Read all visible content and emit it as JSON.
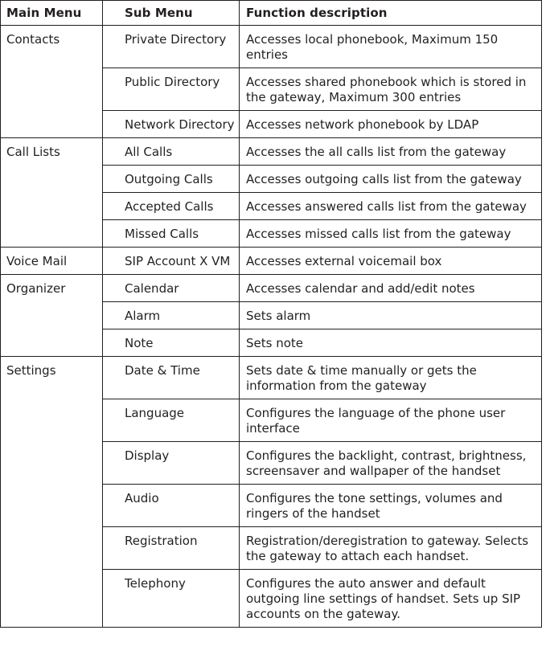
{
  "table": {
    "headers": {
      "main_menu": "Main Menu",
      "sub_menu": "Sub Menu",
      "function_description": "Function description"
    },
    "groups": [
      {
        "main": "Contacts",
        "rows": [
          {
            "sub": "Private Directory",
            "desc": "Accesses local phonebook, Maximum 150 entries"
          },
          {
            "sub": "Public Directory",
            "desc": "Accesses shared phonebook which is stored in the gateway, Maximum 300 entries"
          },
          {
            "sub": "Network Directory",
            "desc": "Accesses network phonebook by LDAP"
          }
        ]
      },
      {
        "main": "Call Lists",
        "rows": [
          {
            "sub": "All Calls",
            "desc": "Accesses the all calls list from the gateway"
          },
          {
            "sub": "Outgoing Calls",
            "desc": "Accesses outgoing calls list from the gateway"
          },
          {
            "sub": "Accepted Calls",
            "desc": "Accesses answered calls list from the gateway"
          },
          {
            "sub": "Missed Calls",
            "desc": "Accesses missed calls list from the gateway"
          }
        ]
      },
      {
        "main": "Voice Mail",
        "rows": [
          {
            "sub": "SIP Account X VM",
            "desc": "Accesses external voicemail box"
          }
        ]
      },
      {
        "main": "Organizer",
        "rows": [
          {
            "sub": "Calendar",
            "desc": "Accesses calendar and add/edit notes"
          },
          {
            "sub": "Alarm",
            "desc": "Sets alarm"
          },
          {
            "sub": "Note",
            "desc": "Sets note"
          }
        ]
      },
      {
        "main": "Settings",
        "rows": [
          {
            "sub": "Date & Time",
            "desc": "Sets date & time manually or gets the information from the gateway"
          },
          {
            "sub": "Language",
            "desc": "Configures the language of the phone user interface"
          },
          {
            "sub": "Display",
            "desc": "Configures the backlight, contrast, brightness, screensaver and wallpaper of the handset"
          },
          {
            "sub": "Audio",
            "desc": "Configures the tone settings, volumes and ringers of the handset"
          },
          {
            "sub": "Registration",
            "desc": "Registration/deregistration to gateway. Selects the gateway to attach each handset."
          },
          {
            "sub": "Telephony",
            "desc": "Configures the auto answer and default outgoing line settings of handset. Sets up SIP accounts on the gateway."
          }
        ]
      }
    ]
  }
}
